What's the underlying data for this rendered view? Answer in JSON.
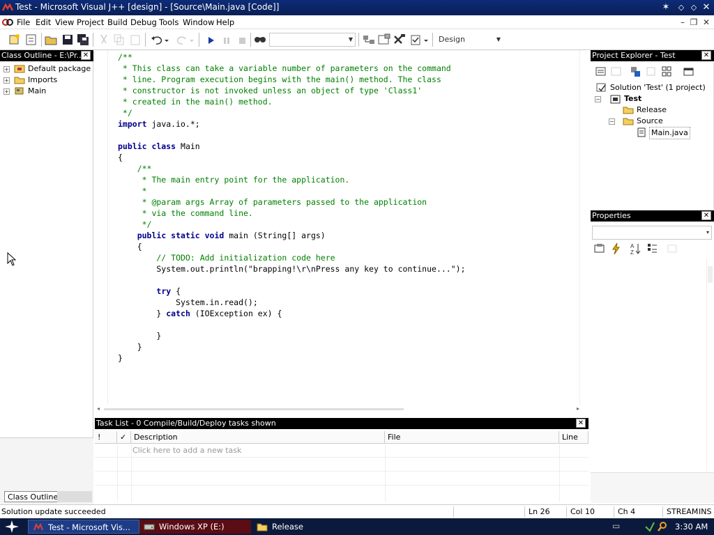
{
  "window": {
    "title": "Test - Microsoft Visual J++ [design] - [Source\\Main.java [Code]]"
  },
  "menu": {
    "items": [
      "File",
      "Edit",
      "View",
      "Project",
      "Build",
      "Debug",
      "Tools",
      "Window",
      "Help"
    ]
  },
  "toolbar": {
    "find_value": "",
    "config_value": "Design"
  },
  "class_outline": {
    "header": "Class Outline - E:\\Pr...",
    "items": [
      "Default package",
      "Imports",
      "Main"
    ],
    "tabs": [
      "Class Outline",
      ""
    ]
  },
  "editor": {
    "lines": [
      [
        {
          "t": "/**",
          "c": "com"
        }
      ],
      [
        {
          "t": " * This class can take a variable number of parameters on the command",
          "c": "com"
        }
      ],
      [
        {
          "t": " * line. Program execution begins with the main() method. The class",
          "c": "com"
        }
      ],
      [
        {
          "t": " * constructor is not invoked unless an object of type 'Class1'",
          "c": "com"
        }
      ],
      [
        {
          "t": " * created in the main() method.",
          "c": "com"
        }
      ],
      [
        {
          "t": " */",
          "c": "com"
        }
      ],
      [
        {
          "t": "import",
          "c": "kw"
        },
        {
          "t": " java.io.*;",
          "c": "pl"
        }
      ],
      [
        {
          "t": "",
          "c": "pl"
        }
      ],
      [
        {
          "t": "public class",
          "c": "kw"
        },
        {
          "t": " Main",
          "c": "pl"
        }
      ],
      [
        {
          "t": "{",
          "c": "pl"
        }
      ],
      [
        {
          "t": "    /**",
          "c": "com"
        }
      ],
      [
        {
          "t": "     * The main entry point for the application.",
          "c": "com"
        }
      ],
      [
        {
          "t": "     *",
          "c": "com"
        }
      ],
      [
        {
          "t": "     * @param args Array of parameters passed to the application",
          "c": "com"
        }
      ],
      [
        {
          "t": "     * via the command line.",
          "c": "com"
        }
      ],
      [
        {
          "t": "     */",
          "c": "com"
        }
      ],
      [
        {
          "t": "    ",
          "c": "pl"
        },
        {
          "t": "public static void",
          "c": "kw"
        },
        {
          "t": " main (String[] args)",
          "c": "pl"
        }
      ],
      [
        {
          "t": "    {",
          "c": "pl"
        }
      ],
      [
        {
          "t": "        // TODO: Add initialization code here",
          "c": "com"
        }
      ],
      [
        {
          "t": "        System.out.println(\"brapping!\\r\\nPress any key to continue...\");",
          "c": "pl"
        }
      ],
      [
        {
          "t": "",
          "c": "pl"
        }
      ],
      [
        {
          "t": "        ",
          "c": "pl"
        },
        {
          "t": "try",
          "c": "kw"
        },
        {
          "t": " {",
          "c": "pl"
        }
      ],
      [
        {
          "t": "            System.in.read();",
          "c": "pl"
        }
      ],
      [
        {
          "t": "        } ",
          "c": "pl"
        },
        {
          "t": "catch",
          "c": "kw"
        },
        {
          "t": " (IOException ex) {",
          "c": "pl"
        }
      ],
      [
        {
          "t": "",
          "c": "pl"
        }
      ],
      [
        {
          "t": "        }",
          "c": "pl"
        }
      ],
      [
        {
          "t": "    }",
          "c": "pl"
        }
      ],
      [
        {
          "t": "}",
          "c": "pl"
        }
      ]
    ]
  },
  "task_list": {
    "header": "Task List - 0 Compile/Build/Deploy tasks shown",
    "columns": [
      "!",
      "✓",
      "Description",
      "File",
      "Line"
    ],
    "add_placeholder": "Click here to add a new task"
  },
  "project_explorer": {
    "header": "Project Explorer - Test",
    "solution": "Solution 'Test' (1 project)",
    "project": "Test",
    "folders": [
      "Release",
      "Source"
    ],
    "file": "Main.java"
  },
  "properties": {
    "header": "Properties",
    "selector_value": ""
  },
  "status": {
    "message": "Solution update succeeded",
    "ln": "Ln 26",
    "col": "Col 10",
    "ch": "Ch 4",
    "mode1": "STREAM",
    "mode2": "INS"
  },
  "taskbar": {
    "items": [
      "Test - Microsoft Vis...",
      "Windows XP (E:)",
      "Release"
    ],
    "clock": "3:30 AM"
  }
}
